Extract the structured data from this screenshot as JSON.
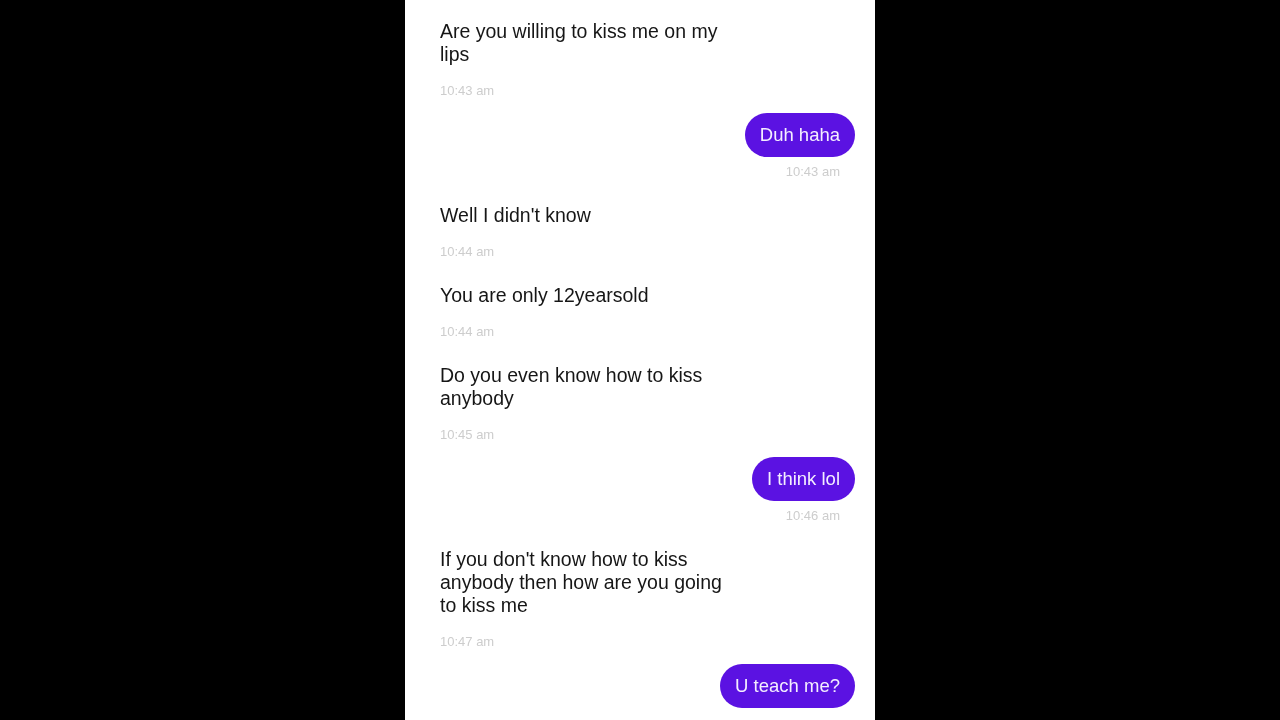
{
  "chat": {
    "messages": [
      {
        "kind": "received",
        "text": "Are you willing to kiss me on my lips",
        "time": "10:43 am"
      },
      {
        "kind": "sent",
        "text": "Duh haha",
        "time": "10:43 am"
      },
      {
        "kind": "received",
        "text": "Well I didn't know",
        "time": "10:44 am"
      },
      {
        "kind": "received",
        "text": "You are only 12yearsold",
        "time": "10:44 am"
      },
      {
        "kind": "received",
        "text": "Do you even know how to kiss anybody",
        "time": "10:45 am"
      },
      {
        "kind": "sent",
        "text": "I think lol",
        "time": "10:46 am"
      },
      {
        "kind": "received",
        "text": "If you don't know how to kiss anybody then how are you going to kiss me",
        "time": "10:47 am"
      },
      {
        "kind": "sent",
        "text": "U teach me?"
      }
    ]
  }
}
